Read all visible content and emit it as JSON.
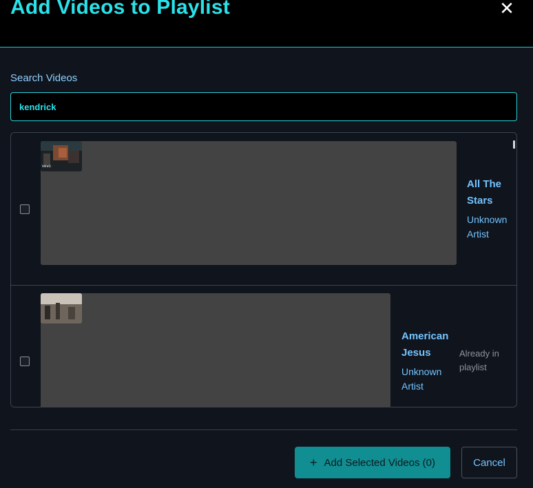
{
  "dialog": {
    "title": "Add Videos to Playlist",
    "close_icon": "close-icon"
  },
  "search": {
    "label": "Search Videos",
    "value": "kendrick"
  },
  "results": [
    {
      "title_line1": "All The",
      "title_line2": "Stars",
      "artist_line1": "Unknown",
      "artist_line2": "Artist",
      "checked": false,
      "status": ""
    },
    {
      "title_line1": "American",
      "title_line2": "Jesus",
      "artist_line1": "Unknown",
      "artist_line2": "Artist",
      "checked": false,
      "status_line1": "Already in",
      "status_line2": "playlist"
    }
  ],
  "footer": {
    "add_label": "Add Selected Videos (0)",
    "add_icon": "plus-icon",
    "cancel_label": "Cancel"
  },
  "colors": {
    "accent": "#29e2ea",
    "link": "#74c4ff",
    "button_primary": "#108e91",
    "background": "#0f141d"
  }
}
